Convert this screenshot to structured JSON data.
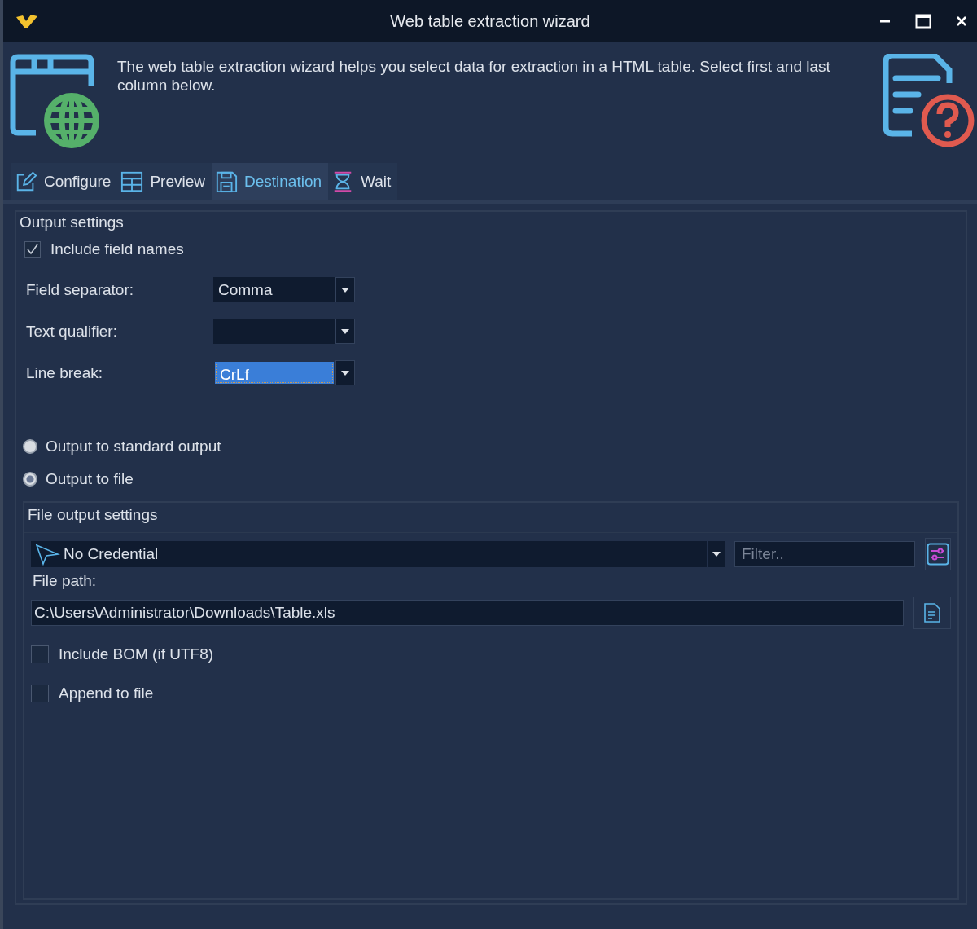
{
  "window": {
    "title": "Web table extraction wizard"
  },
  "header": {
    "description": "The web table extraction wizard helps you select data for extraction in a HTML table. Select first and last column below."
  },
  "tabs": [
    {
      "label": "Configure",
      "selected": false
    },
    {
      "label": "Preview",
      "selected": false
    },
    {
      "label": "Destination",
      "selected": true
    },
    {
      "label": "Wait",
      "selected": false
    }
  ],
  "output_settings": {
    "title": "Output settings",
    "include_field_names": {
      "label": "Include field names",
      "checked": true
    },
    "fields": [
      {
        "label": "Field separator:",
        "value": "Comma",
        "focused": false
      },
      {
        "label": "Text qualifier:",
        "focused": false
      },
      {
        "label": "Line break:",
        "value": "CrLf",
        "focused": true
      }
    ]
  },
  "output_options": [
    {
      "label": "Output to standard output",
      "selected": false
    },
    {
      "label": "Output to file",
      "selected": true
    }
  ],
  "file_output": {
    "title": "File output settings",
    "credential": {
      "value": "No Credential"
    },
    "filter": {
      "placeholder": "Filter.."
    },
    "file_path": {
      "label": "File path:",
      "value": "C:\\Users\\Administrator\\Downloads\\Table.xls"
    },
    "checkboxes": [
      {
        "label": "Include BOM (if UTF8)",
        "checked": false
      },
      {
        "label": "Append to file",
        "checked": false
      }
    ]
  }
}
